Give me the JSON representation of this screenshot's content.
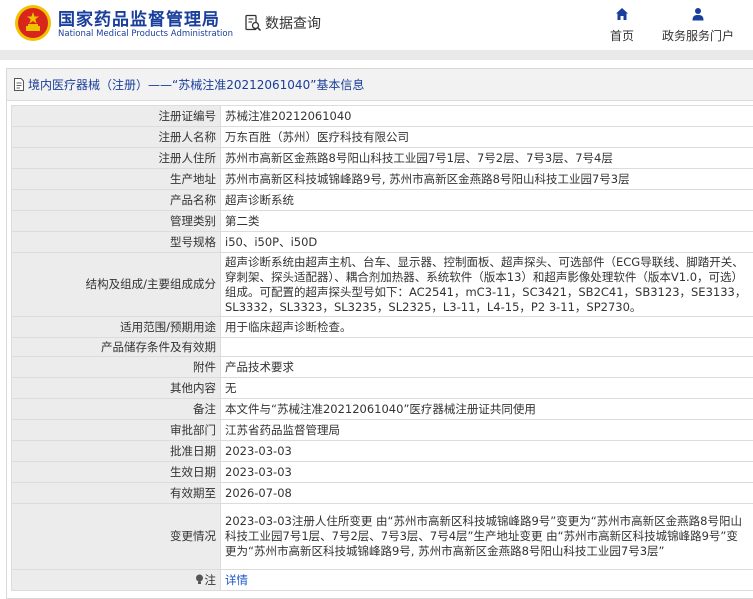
{
  "header": {
    "logo_cn": "国家药品监督管理局",
    "logo_en": "National Medical Products Administration",
    "query_label": "数据查询",
    "nav": {
      "home_label": "首页",
      "portal_label": "政务服务门户"
    },
    "colors": {
      "brand": "#1a3e9b",
      "emblem_red": "#d9261c",
      "emblem_gold": "#f2c200"
    }
  },
  "panel": {
    "title": "境内医疗器械（注册）——“苏械注准20212061040”基本信息"
  },
  "rows": [
    {
      "label": "注册证编号",
      "value": "苏械注准20212061040"
    },
    {
      "label": "注册人名称",
      "value": "万东百胜（苏州）医疗科技有限公司"
    },
    {
      "label": "注册人住所",
      "value": "苏州市高新区金燕路8号阳山科技工业园7号1层、7号2层、7号3层、7号4层"
    },
    {
      "label": "生产地址",
      "value": "苏州市高新区科技城锦峰路9号, 苏州市高新区金燕路8号阳山科技工业园7号3层"
    },
    {
      "label": "产品名称",
      "value": "超声诊断系统"
    },
    {
      "label": "管理类别",
      "value": "第二类"
    },
    {
      "label": "型号规格",
      "value": "i50、i50P、i50D"
    },
    {
      "label": "结构及组成/主要组成成分",
      "value": "超声诊断系统由超声主机、台车、显示器、控制面板、超声探头、可选部件（ECG导联线、脚踏开关、穿刺架、探头适配器）、耦合剂加热器、系统软件（版本13）和超声影像处理软件（版本V1.0，可选）组成。可配置的超声探头型号如下：AC2541，mC3-11，SC3421，SB2C41，SB3123，SE3133，SL3332，SL3323，SL3235，SL2325，L3-11，L4-15，P2 3-11，SP2730。"
    },
    {
      "label": "适用范围/预期用途",
      "value": "用于临床超声诊断检查。"
    },
    {
      "label": "产品储存条件及有效期",
      "value": ""
    },
    {
      "label": "附件",
      "value": "产品技术要求"
    },
    {
      "label": "其他内容",
      "value": "无"
    },
    {
      "label": "备注",
      "value": "本文件与“苏械注准20212061040”医疗器械注册证共同使用"
    },
    {
      "label": "审批部门",
      "value": "江苏省药品监督管理局"
    },
    {
      "label": "批准日期",
      "value": "2023-03-03"
    },
    {
      "label": "生效日期",
      "value": "2023-03-03"
    },
    {
      "label": "有效期至",
      "value": "2026-07-08"
    },
    {
      "label": "变更情况",
      "value": "2023-03-03注册人住所变更 由“苏州市高新区科技城锦峰路9号”变更为“苏州市高新区金燕路8号阳山科技工业园7号1层、7号2层、7号3层、7号4层”生产地址变更 由“苏州市高新区科技城锦峰路9号”变更为“苏州市高新区科技城锦峰路9号, 苏州市高新区金燕路8号阳山科技工业园7号3层”"
    }
  ],
  "note": {
    "label": "注",
    "icon": "lightbulb-icon",
    "link_text": "详情"
  }
}
